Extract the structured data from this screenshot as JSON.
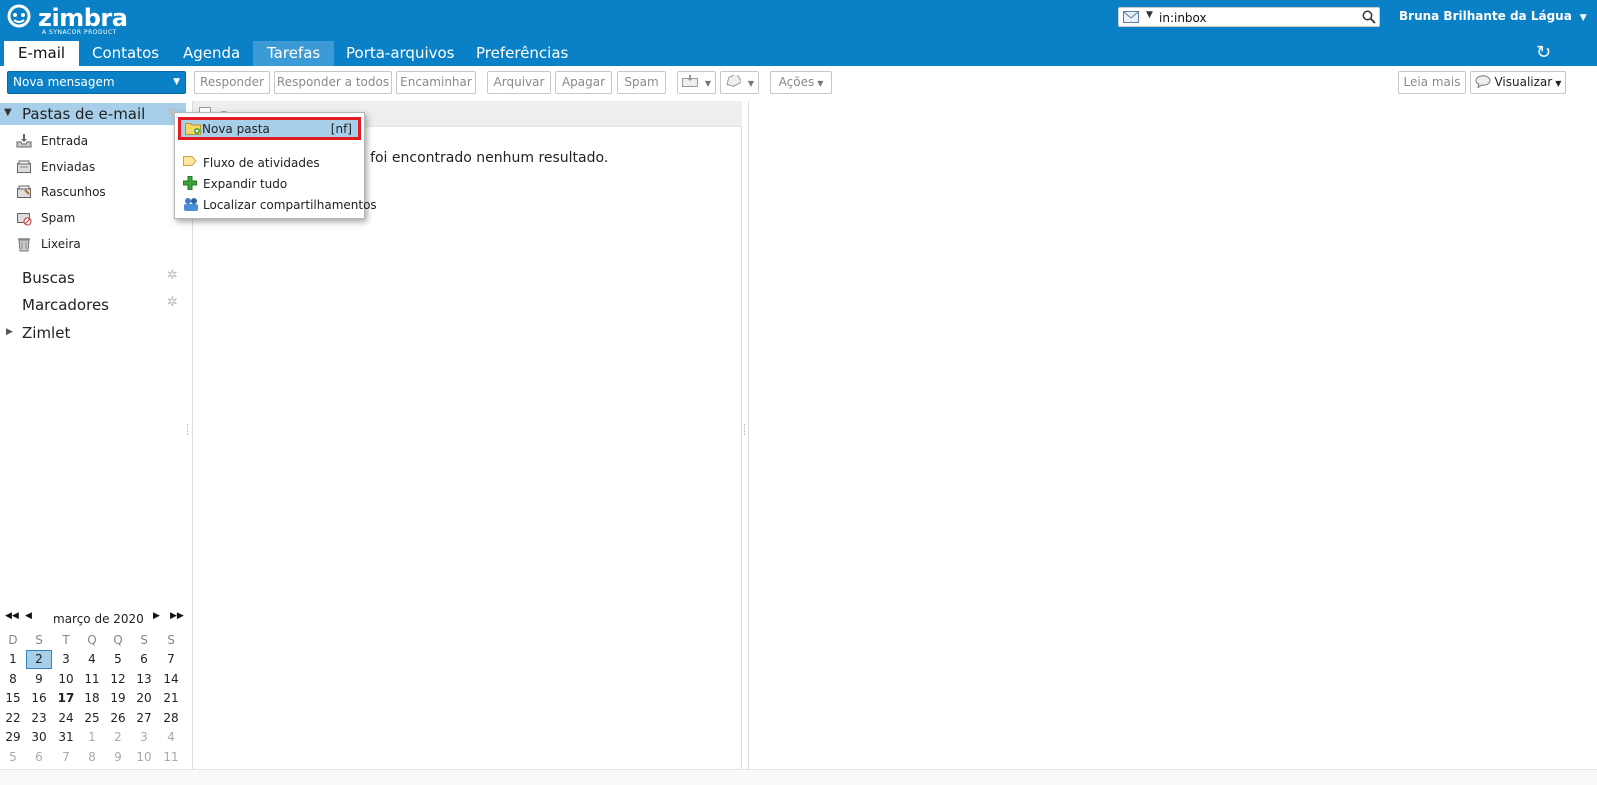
{
  "app": {
    "logo_text": "zimbra",
    "logo_sub": "A SYNACOR PRODUCT",
    "search_value": "in:inbox",
    "user_name": "Bruna Brilhante da Lágua",
    "accent_color": "#0a81c6",
    "selection_color": "#a7cfe9",
    "highlight_border_color": "#e31b23"
  },
  "tabs": [
    {
      "label": "E-mail",
      "state": "active"
    },
    {
      "label": "Contatos",
      "state": "normal"
    },
    {
      "label": "Agenda",
      "state": "normal"
    },
    {
      "label": "Tarefas",
      "state": "hover"
    },
    {
      "label": "Porta-arquivos",
      "state": "normal"
    },
    {
      "label": "Preferências",
      "state": "normal"
    }
  ],
  "toolbar": {
    "new_message": "Nova mensagem",
    "reply": "Responder",
    "reply_all": "Responder a todos",
    "forward": "Encaminhar",
    "archive": "Arquivar",
    "delete": "Apagar",
    "spam": "Spam",
    "actions": "Ações",
    "read_more": "Leia mais",
    "view": "Visualizar"
  },
  "sidebar": {
    "mail_folders_header": "Pastas de e-mail",
    "folders": [
      {
        "label": "Entrada",
        "icon": "inbox-icon"
      },
      {
        "label": "Enviadas",
        "icon": "sent-icon"
      },
      {
        "label": "Rascunhos",
        "icon": "drafts-icon"
      },
      {
        "label": "Spam",
        "icon": "spam-icon"
      },
      {
        "label": "Lixeira",
        "icon": "trash-icon"
      }
    ],
    "searches": "Buscas",
    "tags": "Marcadores",
    "zimlet": "Zimlet"
  },
  "calendar": {
    "month_label": "março de 2020",
    "weekdays": [
      "D",
      "S",
      "T",
      "Q",
      "Q",
      "S",
      "S"
    ],
    "weeks": [
      [
        "1",
        "2",
        "3",
        "4",
        "5",
        "6",
        "7"
      ],
      [
        "8",
        "9",
        "10",
        "11",
        "12",
        "13",
        "14"
      ],
      [
        "15",
        "16",
        "17",
        "18",
        "19",
        "20",
        "21"
      ],
      [
        "22",
        "23",
        "24",
        "25",
        "26",
        "27",
        "28"
      ],
      [
        "29",
        "30",
        "31",
        "1",
        "2",
        "3",
        "4"
      ],
      [
        "5",
        "6",
        "7",
        "8",
        "9",
        "10",
        "11"
      ]
    ],
    "selected_day": "2",
    "today": "17"
  },
  "message_list": {
    "no_results": "Não foi encontrado nenhum resultado."
  },
  "context_menu": {
    "items": [
      {
        "label": "Nova pasta",
        "shortcut": "[nf]",
        "icon": "new-folder-icon"
      },
      {
        "label": "Fluxo de atividades",
        "shortcut": "",
        "icon": "activity-stream-icon"
      },
      {
        "label": "Expandir tudo",
        "shortcut": "",
        "icon": "expand-all-icon"
      },
      {
        "label": "Localizar compartilhamentos",
        "shortcut": "",
        "icon": "find-shares-icon"
      }
    ]
  }
}
